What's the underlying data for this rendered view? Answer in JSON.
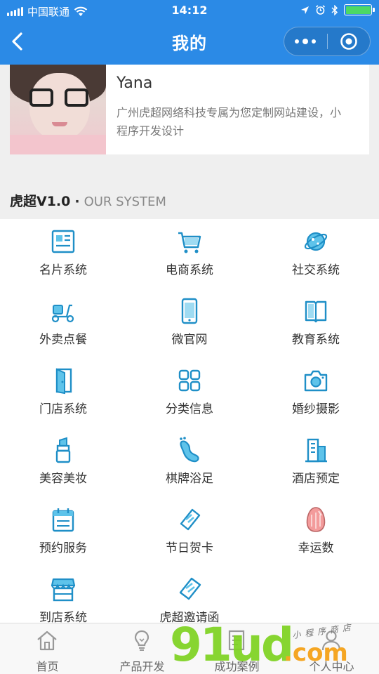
{
  "status_bar": {
    "carrier": "中国联通",
    "time": "14:12"
  },
  "nav": {
    "title": "我的"
  },
  "profile": {
    "name": "Yana",
    "description": "广州虎超网络科技专属为您定制网站建设，小程序开发设计"
  },
  "section": {
    "title": "虎超V1.0",
    "separator": "·",
    "subtitle": "OUR SYSTEM"
  },
  "grid": {
    "items": [
      {
        "label": "名片系统",
        "icon": "business-card-icon"
      },
      {
        "label": "电商系统",
        "icon": "shopping-cart-icon"
      },
      {
        "label": "社交系统",
        "icon": "planet-icon"
      },
      {
        "label": "外卖点餐",
        "icon": "scooter-icon"
      },
      {
        "label": "微官网",
        "icon": "phone-icon"
      },
      {
        "label": "教育系统",
        "icon": "book-icon"
      },
      {
        "label": "门店系统",
        "icon": "door-icon"
      },
      {
        "label": "分类信息",
        "icon": "category-grid-icon"
      },
      {
        "label": "婚纱摄影",
        "icon": "camera-icon"
      },
      {
        "label": "美容美妆",
        "icon": "lipstick-icon"
      },
      {
        "label": "棋牌浴足",
        "icon": "foot-icon"
      },
      {
        "label": "酒店预定",
        "icon": "building-icon"
      },
      {
        "label": "预约服务",
        "icon": "calendar-icon"
      },
      {
        "label": "节日贺卡",
        "icon": "ticket-icon"
      },
      {
        "label": "幸运数",
        "icon": "egg-icon"
      },
      {
        "label": "到店系统",
        "icon": "storefront-icon"
      },
      {
        "label": "虎超邀请函",
        "icon": "invitation-ticket-icon"
      }
    ]
  },
  "tabbar": {
    "items": [
      {
        "label": "首页",
        "icon": "home-icon"
      },
      {
        "label": "产品开发",
        "icon": "lightbulb-icon"
      },
      {
        "label": "成功案例",
        "icon": "document-icon"
      },
      {
        "label": "个人中心",
        "icon": "user-icon"
      }
    ]
  },
  "watermark": {
    "brand": "91ud",
    "domain": ".com",
    "tagline": "小程序商店"
  },
  "colors": {
    "nav_blue": "#2b8ae6",
    "icon_blue": "#3aa7d8",
    "battery_green": "#4cd964",
    "watermark_green": "#7ed321",
    "watermark_orange": "#f5a623"
  }
}
